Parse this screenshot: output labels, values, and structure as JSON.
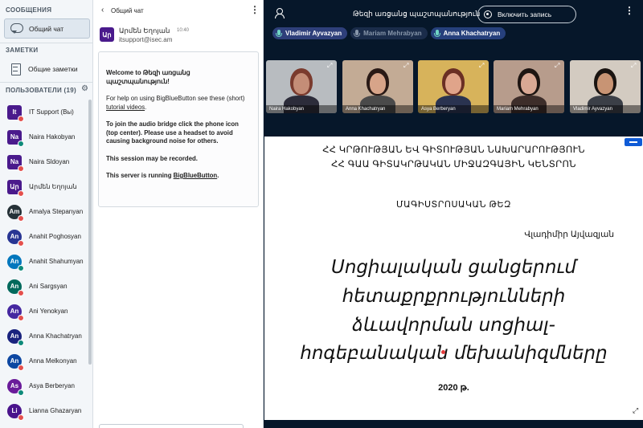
{
  "sidebar": {
    "messages_heading": "СООБЩЕНИЯ",
    "public_chat_label": "Общий чат",
    "notes_heading": "ЗАМЕТКИ",
    "shared_notes_label": "Общие заметки",
    "users_heading": "ПОЛЬЗОВАТЕЛИ (19)",
    "users": [
      {
        "initials": "It",
        "name": "IT Support (Вы)",
        "color": "#4a1a8c",
        "square": true,
        "status": "red"
      },
      {
        "initials": "Na",
        "name": "Naira Hakobyan",
        "color": "#4a1a8c",
        "square": true,
        "status": "teal"
      },
      {
        "initials": "Na",
        "name": "Naira Sldoyan",
        "color": "#4a1a8c",
        "square": true,
        "status": "red"
      },
      {
        "initials": "Ար",
        "name": "Արմեն Եղոյան",
        "color": "#4a1a8c",
        "square": true,
        "status": "red"
      },
      {
        "initials": "Am",
        "name": "Amalya Stepanyan",
        "color": "#263238",
        "square": false,
        "status": "red"
      },
      {
        "initials": "An",
        "name": "Anahit Poghosyan",
        "color": "#283593",
        "square": false,
        "status": "red"
      },
      {
        "initials": "An",
        "name": "Anahit Shahumyan",
        "color": "#0277bd",
        "square": false,
        "status": "teal"
      },
      {
        "initials": "An",
        "name": "Ani Sargsyan",
        "color": "#00695c",
        "square": false,
        "status": "red"
      },
      {
        "initials": "An",
        "name": "Ani Yenokyan",
        "color": "#4527a0",
        "square": false,
        "status": "red"
      },
      {
        "initials": "An",
        "name": "Anna Khachatryan",
        "color": "#1a237e",
        "square": false,
        "status": "teal"
      },
      {
        "initials": "An",
        "name": "Anna Melkonyan",
        "color": "#0d47a1",
        "square": false,
        "status": "red"
      },
      {
        "initials": "As",
        "name": "Asya Berberyan",
        "color": "#6a1b9a",
        "square": false,
        "status": "teal"
      },
      {
        "initials": "Li",
        "name": "Lianna Ghazaryan",
        "color": "#4a148c",
        "square": false,
        "status": "red"
      }
    ]
  },
  "chat": {
    "title": "Общий чат",
    "back_icon": "chevron-left-icon",
    "message": {
      "avatar_initials": "Ար",
      "author": "Արմեն Եղոյան",
      "time": "10:40",
      "text": "itsupport@isec.am"
    },
    "welcome": {
      "line1": "Welcome to Թեզի առցանց պաշտպանություն!",
      "p2_before": "For help on using BigBlueButton see these (short) ",
      "p2_link": "tutorial videos",
      "p2_after": ".",
      "p3": "To join the audio bridge click the phone icon (top center). Please use a headset to avoid causing background noise for others.",
      "p4": "This session may be recorded.",
      "p5_before": "This server is running ",
      "p5_link": "BigBlueButton",
      "p5_after": "."
    }
  },
  "main": {
    "meeting_title": "Թեզի առցանց պաշտպանություն",
    "record_label": "Включить запись",
    "talkers": [
      {
        "name": "Vladimir Ayvazyan",
        "state": "active"
      },
      {
        "name": "Mariam Mehrabyan",
        "state": "inactive"
      },
      {
        "name": "Anna Khachatryan",
        "state": "active-alt"
      }
    ],
    "videos": [
      {
        "name": "Naira Hakobyan",
        "bg": "#b8bcc0",
        "skin": "#c48d77",
        "hair": "#7a3b2e",
        "shirt": "#2c2c3a"
      },
      {
        "name": "Anna Khachatryan",
        "bg": "#c3ab95",
        "skin": "#d7a489",
        "hair": "#2a1a16",
        "shirt": "#4a4a4a"
      },
      {
        "name": "Asya Berberyan",
        "bg": "#d7b35b",
        "skin": "#e0a48a",
        "hair": "#6a2f24",
        "shirt": "#2a3350"
      },
      {
        "name": "Mariam Mehrabyan",
        "bg": "#b79c8c",
        "skin": "#d9a894",
        "hair": "#1e1512",
        "shirt": "#3d2d2a"
      },
      {
        "name": "Vladimir Ayvazyan",
        "bg": "#d3cbc1",
        "skin": "#c89474",
        "hair": "#1a1411",
        "shirt": "#3b3f47"
      }
    ],
    "slide": {
      "header1": "ՀՀ ԿՐԹՈՒԹՅԱՆ ԵՎ ԳԻՏՈՒԹՅԱՆ ՆԱԽԱՐԱՐՈՒԹՅՈՒՆ",
      "header2": "ՀՀ ԳԱԱ ԳԻՏԱԿՐԹԱԿԱՆ ՄԻՋԱԶԳԱՅԻՆ ԿԵՆՏՐՈՆ",
      "type": "ՄԱԳԻՍՏՐՈՍԱԿԱՆ ԹԵԶ",
      "author": "Վլադիմիր Այվազյան",
      "title_lines": [
        "Սոցիալական ցանցերում",
        "հետաքրքրությունների",
        "ձևավորման սոցիալ-",
        "հոգեբանական մեխանիզմները"
      ],
      "year": "2020 թ."
    }
  }
}
